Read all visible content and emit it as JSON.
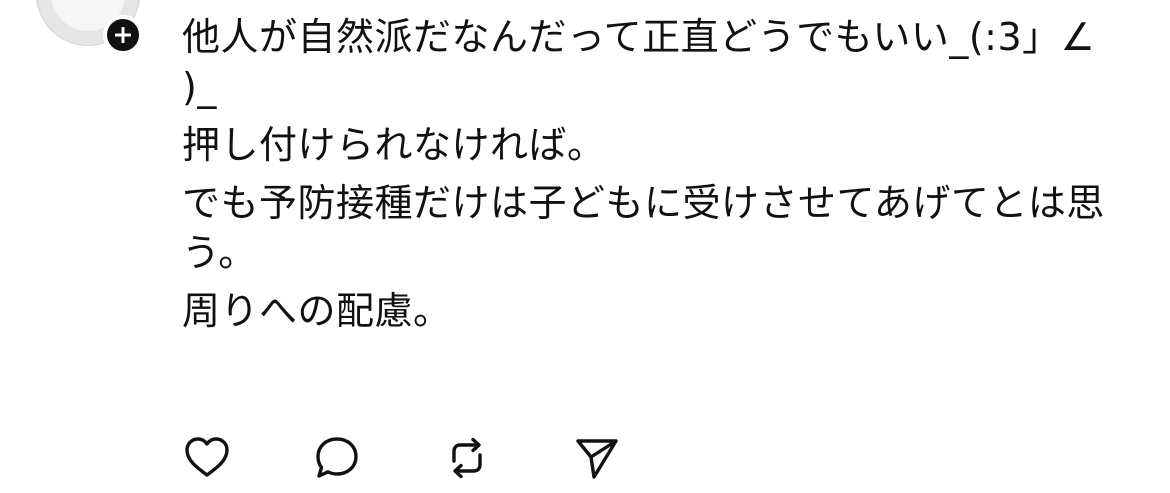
{
  "post": {
    "lines": [
      "他人が自然派だなんだって正直どうでもいい_(:3」∠ )_",
      "押し付けられなければ。",
      "でも予防接種だけは子どもに受けさせてあげてとは思う。",
      "周りへの配慮。"
    ]
  },
  "author": {
    "avatar_icon": "avatar-placeholder",
    "follow_icon": "plus-icon"
  },
  "actions": [
    {
      "name": "like",
      "icon": "heart-icon"
    },
    {
      "name": "reply",
      "icon": "comment-icon"
    },
    {
      "name": "repost",
      "icon": "repost-icon"
    },
    {
      "name": "share",
      "icon": "send-icon"
    }
  ],
  "colors": {
    "text": "#111111",
    "background": "#ffffff",
    "badge": "#111111",
    "icon_stroke": "#111111"
  }
}
